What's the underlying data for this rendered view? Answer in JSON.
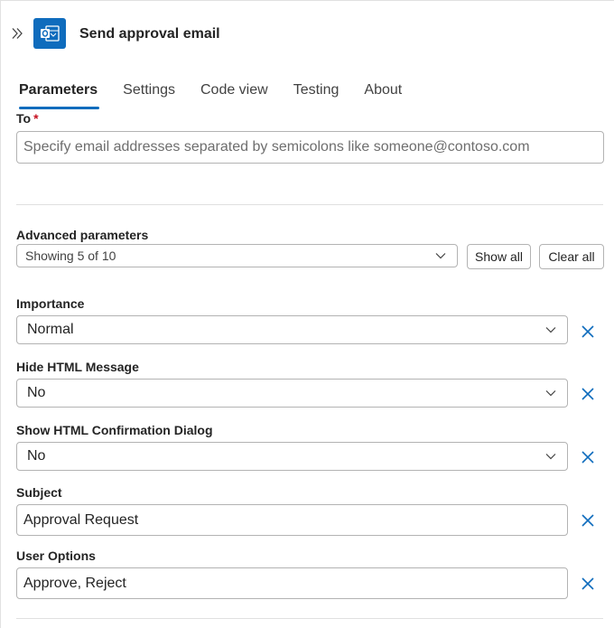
{
  "header": {
    "title": "Send approval email",
    "icon": "outlook-icon"
  },
  "tabs": [
    {
      "label": "Parameters",
      "active": true
    },
    {
      "label": "Settings",
      "active": false
    },
    {
      "label": "Code view",
      "active": false
    },
    {
      "label": "Testing",
      "active": false
    },
    {
      "label": "About",
      "active": false
    }
  ],
  "to": {
    "label": "To",
    "required_mark": "*",
    "placeholder": "Specify email addresses separated by semicolons like someone@contoso.com",
    "value": ""
  },
  "advanced": {
    "label": "Advanced parameters",
    "selected": "Showing 5 of 10",
    "show_all_label": "Show all",
    "clear_all_label": "Clear all"
  },
  "params": [
    {
      "label": "Importance",
      "value": "Normal",
      "type": "dropdown"
    },
    {
      "label": "Hide HTML Message",
      "value": "No",
      "type": "dropdown"
    },
    {
      "label": "Show HTML Confirmation Dialog",
      "value": "No",
      "type": "dropdown"
    },
    {
      "label": "Subject",
      "value": "Approval Request",
      "type": "text"
    },
    {
      "label": "User Options",
      "value": "Approve, Reject",
      "type": "text"
    }
  ],
  "colors": {
    "accent": "#0f6cbd",
    "required": "#c50f1f"
  }
}
